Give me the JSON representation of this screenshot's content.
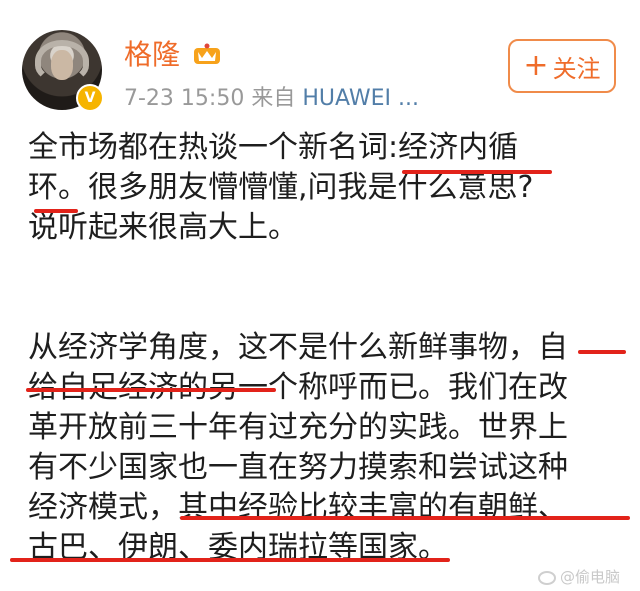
{
  "header": {
    "username": "格隆",
    "date": "7-23 15:50",
    "source_prefix": "来自",
    "source_name": "HUAWEI ...",
    "follow_label": "关注"
  },
  "post": {
    "lines": [
      "全市场都在热谈一个新名词:经济内循",
      "环。很多朋友懵懵懂,问我是什么意思?",
      "说听起来很高大上。",
      "从经济学角度，这不是什么新鲜事物，自",
      "给自足经济的另一个称呼而已。我们在改",
      "革开放前三十年有过充分的实践。世界上",
      "有不少国家也一直在努力摸索和尝试这种",
      "经济模式，其中经验比较丰富的有朝鲜、",
      "古巴、伊朗、委内瑞拉等国家。"
    ]
  },
  "watermark": {
    "text": "@偷电脑"
  },
  "colors": {
    "name": "#ef6c2a",
    "underline": "#e2231a",
    "source_link": "#527ea8",
    "verified_badge": "#f6b400"
  },
  "icons": [
    "avatar",
    "verified-badge-icon",
    "vip-crown-icon",
    "plus-icon",
    "weibo-logo-icon"
  ]
}
